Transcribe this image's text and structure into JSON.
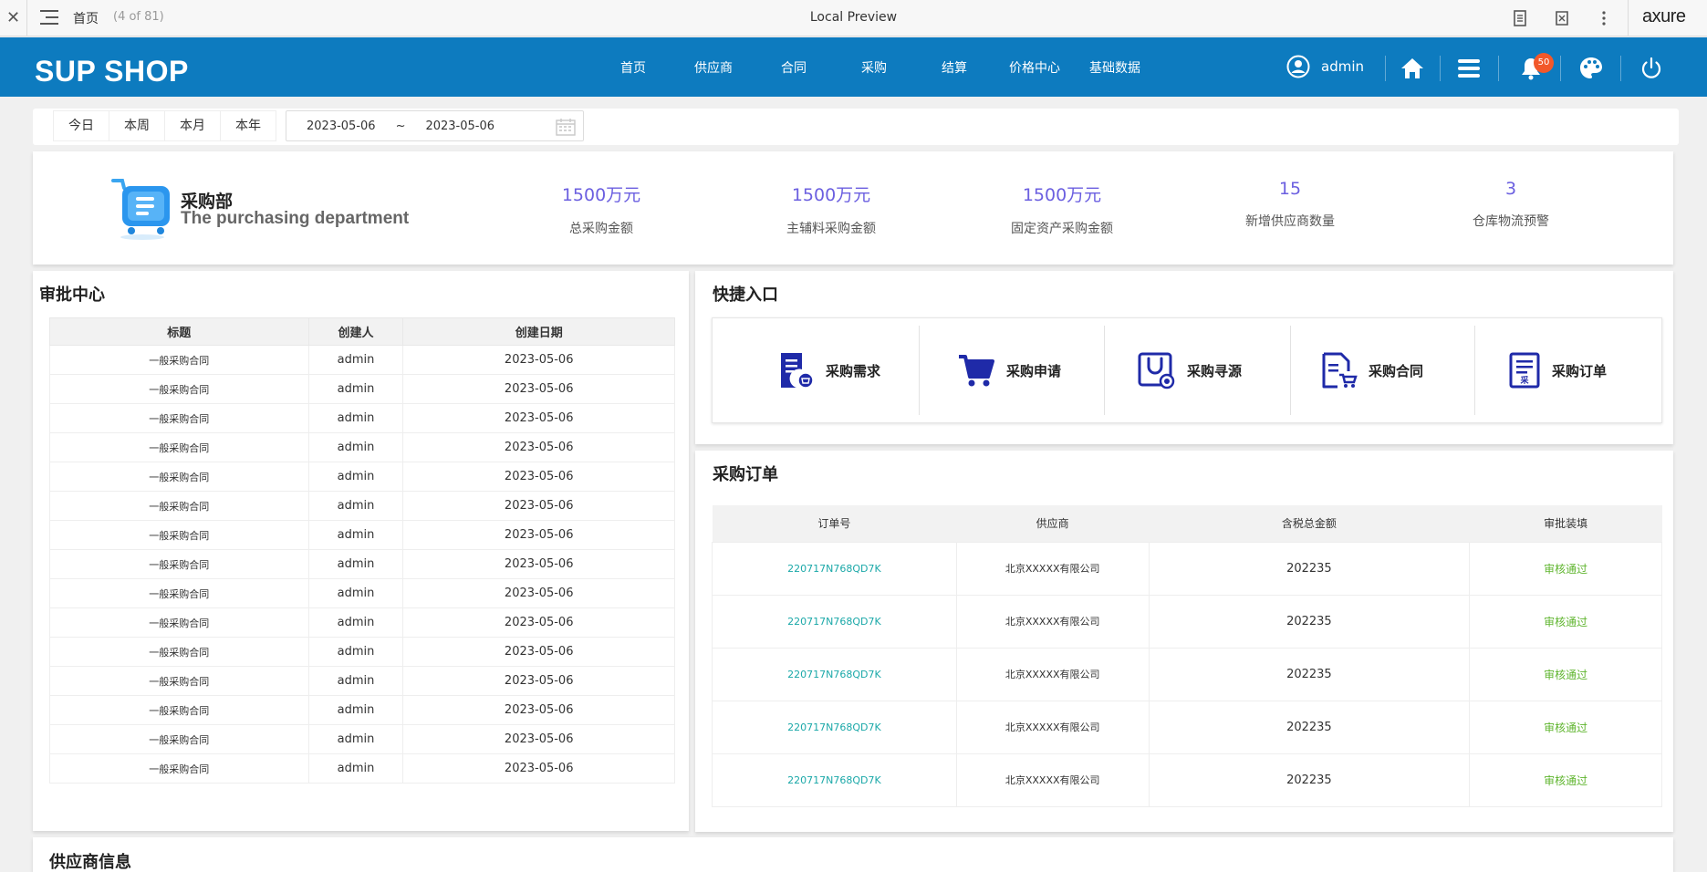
{
  "preview": {
    "page_name": "首页",
    "page_count": "(4 of 81)",
    "title": "Local Preview",
    "brand": "axure"
  },
  "header": {
    "logo": "SUP SHOP",
    "nav": [
      "首页",
      "供应商",
      "合同",
      "采购",
      "结算",
      "价格中心",
      "基础数据"
    ],
    "username": "admin",
    "notification_count": "50"
  },
  "filter": {
    "tabs": [
      "今日",
      "本周",
      "本月",
      "本年"
    ],
    "date_start": "2023-05-06",
    "separator": "~",
    "date_end": "2023-05-06"
  },
  "department": {
    "name": "采购部",
    "name_en": "The purchasing department"
  },
  "stats": [
    {
      "value": "1500万元",
      "label": "总采购金额"
    },
    {
      "value": "1500万元",
      "label": "主辅料采购金额"
    },
    {
      "value": "1500万元",
      "label": "固定资产采购金额"
    },
    {
      "value": "15",
      "label": "新增供应商数量"
    },
    {
      "value": "3",
      "label": "仓库物流预警"
    }
  ],
  "approval": {
    "title": "审批中心",
    "columns": [
      "标题",
      "创建人",
      "创建日期"
    ],
    "rows": [
      [
        "一般采购合同",
        "admin",
        "2023-05-06"
      ],
      [
        "一般采购合同",
        "admin",
        "2023-05-06"
      ],
      [
        "一般采购合同",
        "admin",
        "2023-05-06"
      ],
      [
        "一般采购合同",
        "admin",
        "2023-05-06"
      ],
      [
        "一般采购合同",
        "admin",
        "2023-05-06"
      ],
      [
        "一般采购合同",
        "admin",
        "2023-05-06"
      ],
      [
        "一般采购合同",
        "admin",
        "2023-05-06"
      ],
      [
        "一般采购合同",
        "admin",
        "2023-05-06"
      ],
      [
        "一般采购合同",
        "admin",
        "2023-05-06"
      ],
      [
        "一般采购合同",
        "admin",
        "2023-05-06"
      ],
      [
        "一般采购合同",
        "admin",
        "2023-05-06"
      ],
      [
        "一般采购合同",
        "admin",
        "2023-05-06"
      ],
      [
        "一般采购合同",
        "admin",
        "2023-05-06"
      ],
      [
        "一般采购合同",
        "admin",
        "2023-05-06"
      ],
      [
        "一般采购合同",
        "admin",
        "2023-05-06"
      ]
    ]
  },
  "quick": {
    "title": "快捷入口",
    "items": [
      {
        "label": "采购需求",
        "icon": "document-cart-icon"
      },
      {
        "label": "采购申请",
        "icon": "shopping-cart-icon"
      },
      {
        "label": "采购寻源",
        "icon": "shopping-bag-icon"
      },
      {
        "label": "采购合同",
        "icon": "contract-cart-icon"
      },
      {
        "label": "采购订单",
        "icon": "order-document-icon"
      }
    ],
    "icon_color": "#1f2aa8"
  },
  "orders": {
    "title": "采购订单",
    "columns": [
      "订单号",
      "供应商",
      "含税总金额",
      "审批装填"
    ],
    "rows": [
      [
        "220717N768QD7K",
        "北京XXXXX有限公司",
        "202235",
        "审核通过"
      ],
      [
        "220717N768QD7K",
        "北京XXXXX有限公司",
        "202235",
        "审核通过"
      ],
      [
        "220717N768QD7K",
        "北京XXXXX有限公司",
        "202235",
        "审核通过"
      ],
      [
        "220717N768QD7K",
        "北京XXXXX有限公司",
        "202235",
        "审核通过"
      ],
      [
        "220717N768QD7K",
        "北京XXXXX有限公司",
        "202235",
        "审核通过"
      ]
    ]
  },
  "supplier": {
    "title": "供应商信息"
  },
  "colors": {
    "header_bg": "#0d7bbf",
    "stat_value": "#6b5fe0",
    "order_link": "#1aa8a8",
    "status_ok": "#5fb52e",
    "badge": "#f2582a"
  }
}
